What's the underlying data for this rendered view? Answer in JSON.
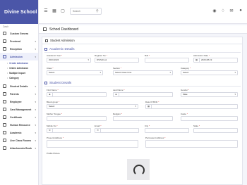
{
  "brand": "Divine School",
  "breadcrumb_home": "Dash",
  "topbar": {
    "search_placeholder": "Search"
  },
  "page_title": "School Dashboard",
  "card_title": "Student Admission",
  "sidebar": {
    "items": [
      {
        "label": "Custom Genera",
        "icon": "globe-icon",
        "active": false
      },
      {
        "label": "Frontend",
        "icon": "window-icon",
        "active": false
      },
      {
        "label": "Reception",
        "icon": "phone-icon",
        "active": false
      },
      {
        "label": "Admission",
        "icon": "user-plus-icon",
        "active": true
      },
      {
        "label": "Student Details",
        "icon": "users-icon",
        "active": false
      },
      {
        "label": "Parents",
        "icon": "parents-icon",
        "active": false
      },
      {
        "label": "Employee",
        "icon": "briefcase-icon",
        "active": false
      },
      {
        "label": "Card Management",
        "icon": "card-icon",
        "active": false
      },
      {
        "label": "Certificate",
        "icon": "certificate-icon",
        "active": false
      },
      {
        "label": "Human Resource",
        "icon": "hr-icon",
        "active": false
      },
      {
        "label": "Academic",
        "icon": "book-icon",
        "active": false
      },
      {
        "label": "Live Class Rooms",
        "icon": "video-icon",
        "active": false
      },
      {
        "label": "Attachments Book",
        "icon": "paperclip-icon",
        "active": false
      }
    ],
    "admission_sub": [
      "Create Admission",
      "Online Admission",
      "Multiple Import",
      "Category"
    ]
  },
  "sections": {
    "academic": "Academic Details",
    "student": "Student Details"
  },
  "fields": {
    "academic_year": {
      "label": "Academic Year",
      "value": "2023-2024"
    },
    "register_no": {
      "label": "Register No",
      "value": "DS/School"
    },
    "roll": {
      "label": "Roll",
      "value": ""
    },
    "admission_date": {
      "label": "Admission Date",
      "value": "2023-08-19"
    },
    "class": {
      "label": "Class",
      "value": "Select"
    },
    "section": {
      "label": "Section",
      "value": "Select Class First"
    },
    "category": {
      "label": "Category",
      "value": "Select"
    },
    "first_name": {
      "label": "First Name",
      "value": ""
    },
    "last_name": {
      "label": "Last Name",
      "value": ""
    },
    "gender": {
      "label": "Gender",
      "value": "Male"
    },
    "blood_group": {
      "label": "Blood group",
      "value": "Select"
    },
    "dob": {
      "label": "Date Of Birth",
      "value": ""
    },
    "mother_tongue": {
      "label": "Mother Tongue",
      "value": ""
    },
    "religion": {
      "label": "Religion",
      "value": ""
    },
    "caste": {
      "label": "Caste",
      "value": ""
    },
    "mobile_no": {
      "label": "Mobile No",
      "value": ""
    },
    "email": {
      "label": "Email",
      "value": ""
    },
    "city": {
      "label": "City",
      "value": ""
    },
    "state": {
      "label": "State",
      "value": ""
    },
    "present_address": {
      "label": "Present Address",
      "value": ""
    },
    "permanent_address": {
      "label": "Permanent Address",
      "value": ""
    },
    "profile_picture": {
      "label": "Profile Picture",
      "value": ""
    }
  }
}
